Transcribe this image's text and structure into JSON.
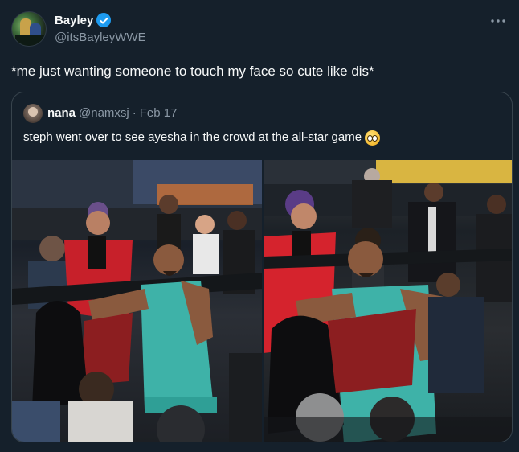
{
  "author": {
    "display_name": "Bayley",
    "handle": "@itsBayleyWWE",
    "verified": true
  },
  "tweet": {
    "text": "*me just wanting someone to touch my face so cute like dis*"
  },
  "more_icon": "more-options-icon",
  "quote": {
    "display_name": "nana",
    "handle": "@namxsj",
    "separator": "·",
    "date": "Feb 17",
    "text": "steph went over to see ayesha in the crowd at the all-star game",
    "emoji": "pleading-face-emoji"
  },
  "colors": {
    "background": "#15202b",
    "text": "#f7f9f9",
    "secondary_text": "#8b98a5",
    "border": "#38444d",
    "verified_blue": "#1d9bf0"
  }
}
